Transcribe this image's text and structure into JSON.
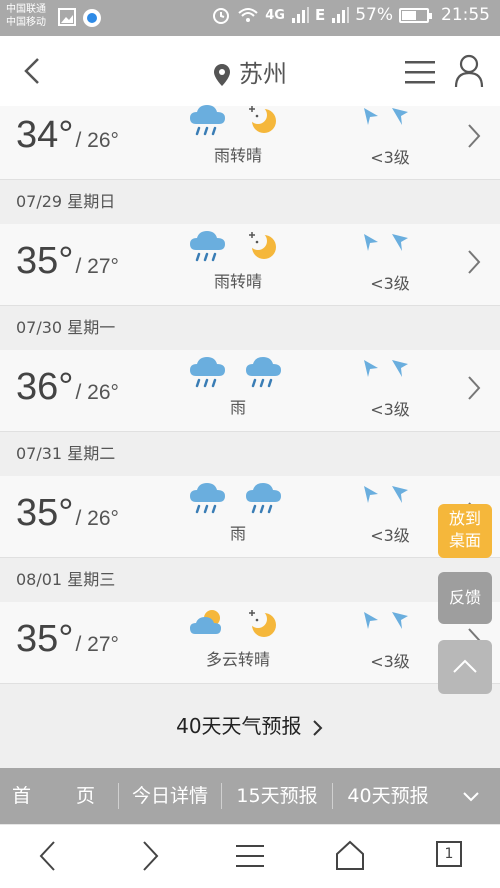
{
  "status_bar": {
    "carrier_1": "中国联通",
    "carrier_2": "中国移动",
    "network": "4G",
    "network_2": "E",
    "battery": "57%",
    "battery_level": 0.57,
    "time": "21:55"
  },
  "header": {
    "city": "苏州"
  },
  "days": [
    {
      "label": "",
      "high": "34°",
      "low": "/ 26°",
      "icons": [
        "rain-cloud-icon",
        "sun-moon-icon"
      ],
      "weather": "雨转晴",
      "wind": "<3级"
    },
    {
      "label": "07/29 星期日",
      "high": "35°",
      "low": "/ 27°",
      "icons": [
        "rain-cloud-icon",
        "sun-moon-icon"
      ],
      "weather": "雨转晴",
      "wind": "<3级"
    },
    {
      "label": "07/30 星期一",
      "high": "36°",
      "low": "/ 26°",
      "icons": [
        "rain-cloud-icon",
        "rain-cloud-icon"
      ],
      "weather": "雨",
      "wind": "<3级"
    },
    {
      "label": "07/31 星期二",
      "high": "35°",
      "low": "/ 26°",
      "icons": [
        "rain-cloud-icon",
        "rain-cloud-icon"
      ],
      "weather": "雨",
      "wind": "<3级"
    },
    {
      "label": "08/01 星期三",
      "high": "35°",
      "low": "/ 27°",
      "icons": [
        "partly-cloudy-icon",
        "sun-moon-icon"
      ],
      "weather": "多云转晴",
      "wind": "<3级"
    }
  ],
  "forecast_link": "40天天气预报",
  "floating": {
    "add_to_desktop": "放到桌面",
    "feedback": "反馈"
  },
  "bottom_nav": {
    "home_1": "首",
    "home_2": "页",
    "today": "今日详情",
    "day15": "15天预报",
    "day40": "40天预报"
  },
  "system_nav": {
    "tab_count": "1"
  },
  "colors": {
    "accent_orange": "#f5b73b",
    "icon_blue": "#6aaede",
    "status_gray": "#a9a9a9"
  }
}
